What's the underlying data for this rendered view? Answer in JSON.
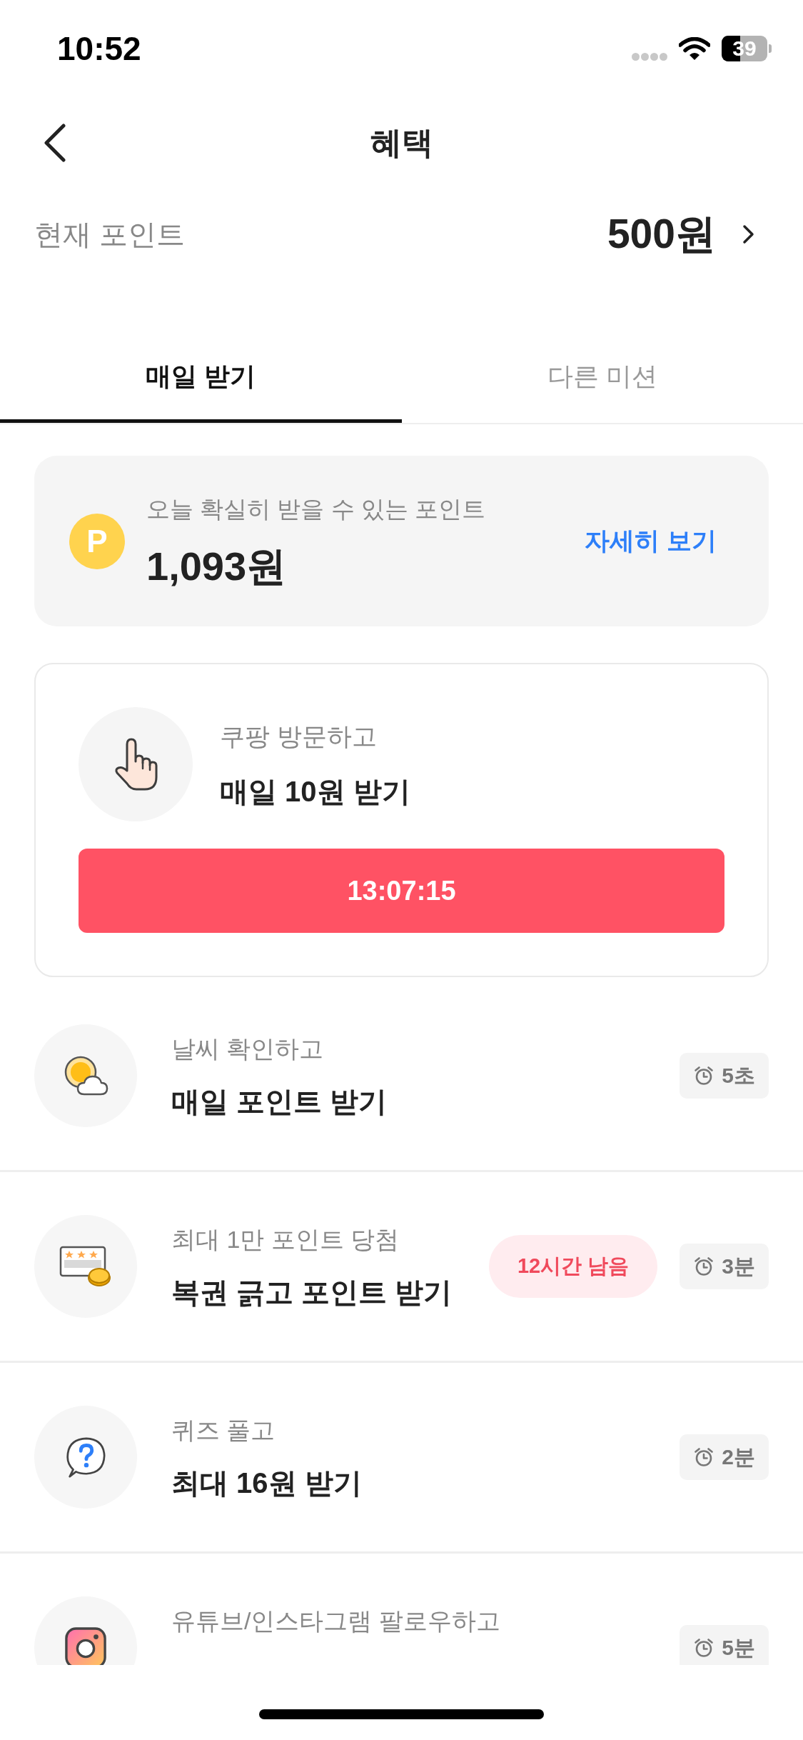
{
  "status_bar": {
    "time": "10:52",
    "battery": "39"
  },
  "header": {
    "title": "혜택"
  },
  "points": {
    "label": "현재 포인트",
    "value": "500원"
  },
  "tabs": [
    {
      "label": "매일 받기",
      "selected": true
    },
    {
      "label": "다른 미션",
      "selected": false
    }
  ],
  "summary": {
    "coin": "P",
    "label": "오늘 확실히 받을 수 있는 포인트",
    "amount": "1,093원",
    "link": "자세히 보기"
  },
  "visit_card": {
    "subtitle": "쿠팡 방문하고",
    "title": "매일 10원 받기",
    "timer": "13:07:15"
  },
  "missions": [
    {
      "kind": "weather",
      "subtitle": "날씨 확인하고",
      "title": "매일 포인트 받기",
      "duration": "5초"
    },
    {
      "kind": "lottery",
      "subtitle": "최대 1만 포인트 당첨",
      "title": "복권 긁고 포인트 받기",
      "badge": "12시간 남음",
      "duration": "3분"
    },
    {
      "kind": "quiz",
      "subtitle": "퀴즈 풀고",
      "title": "최대 16원 받기",
      "duration": "2분"
    },
    {
      "kind": "camera",
      "subtitle": "유튜브/인스타그램 팔로우하고",
      "duration": "5분"
    }
  ]
}
